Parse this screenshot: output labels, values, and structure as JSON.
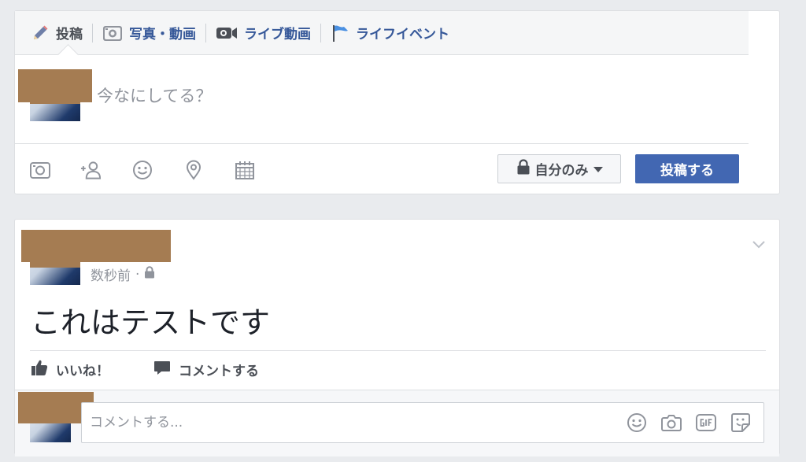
{
  "composer": {
    "tabs": [
      {
        "label": "投稿",
        "icon": "pencil-icon"
      },
      {
        "label": "写真・動画",
        "icon": "camera-icon"
      },
      {
        "label": "ライブ動画",
        "icon": "video-camera-icon"
      },
      {
        "label": "ライフイベント",
        "icon": "flag-icon"
      }
    ],
    "placeholder": "今なにしてる？",
    "tools": [
      "photo-icon",
      "tag-friends-icon",
      "feeling-icon",
      "location-icon",
      "calendar-icon"
    ],
    "privacy_label": "自分のみ",
    "post_button": "投稿する"
  },
  "post": {
    "timestamp": "数秒前",
    "meta_separator": "·",
    "text": "これはテストです",
    "like_label": "いいね！",
    "comment_label": "コメントする",
    "comment_placeholder": "コメントする...",
    "comment_tools": [
      "emoji-icon",
      "camera-icon",
      "gif-icon",
      "sticker-icon"
    ]
  },
  "colors": {
    "background": "#e9ebee",
    "brand": "#4267b2",
    "link": "#365899",
    "redaction": "#a57c52"
  }
}
